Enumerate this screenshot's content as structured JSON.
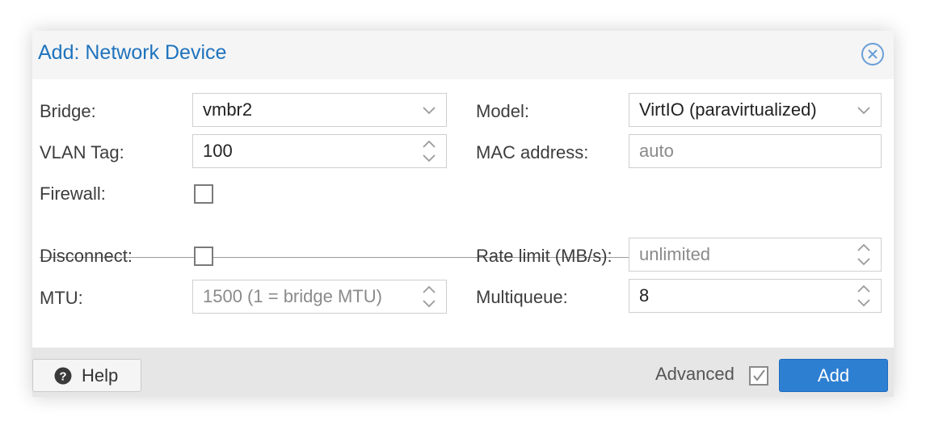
{
  "dialog": {
    "title": "Add: Network Device",
    "close_icon": "close-circle-icon"
  },
  "left": {
    "bridge": {
      "label": "Bridge:",
      "value": "vmbr2"
    },
    "vlan_tag": {
      "label": "VLAN Tag:",
      "value": "100"
    },
    "firewall": {
      "label": "Firewall:",
      "checked": false
    },
    "disconnect": {
      "label": "Disconnect:",
      "checked": false
    },
    "mtu": {
      "label": "MTU:",
      "placeholder": "1500 (1 = bridge MTU)"
    }
  },
  "right": {
    "model": {
      "label": "Model:",
      "value": "VirtIO (paravirtualized)"
    },
    "mac_address": {
      "label": "MAC address:",
      "placeholder": "auto"
    },
    "rate_limit": {
      "label": "Rate limit (MB/s):",
      "placeholder": "unlimited"
    },
    "multiqueue": {
      "label": "Multiqueue:",
      "value": "8"
    }
  },
  "footer": {
    "help_label": "Help",
    "help_icon": "question-circle-icon",
    "advanced_label": "Advanced",
    "advanced_checked": true,
    "add_label": "Add"
  },
  "colors": {
    "title": "#1e73be",
    "primary_button": "#2d7fd2"
  }
}
